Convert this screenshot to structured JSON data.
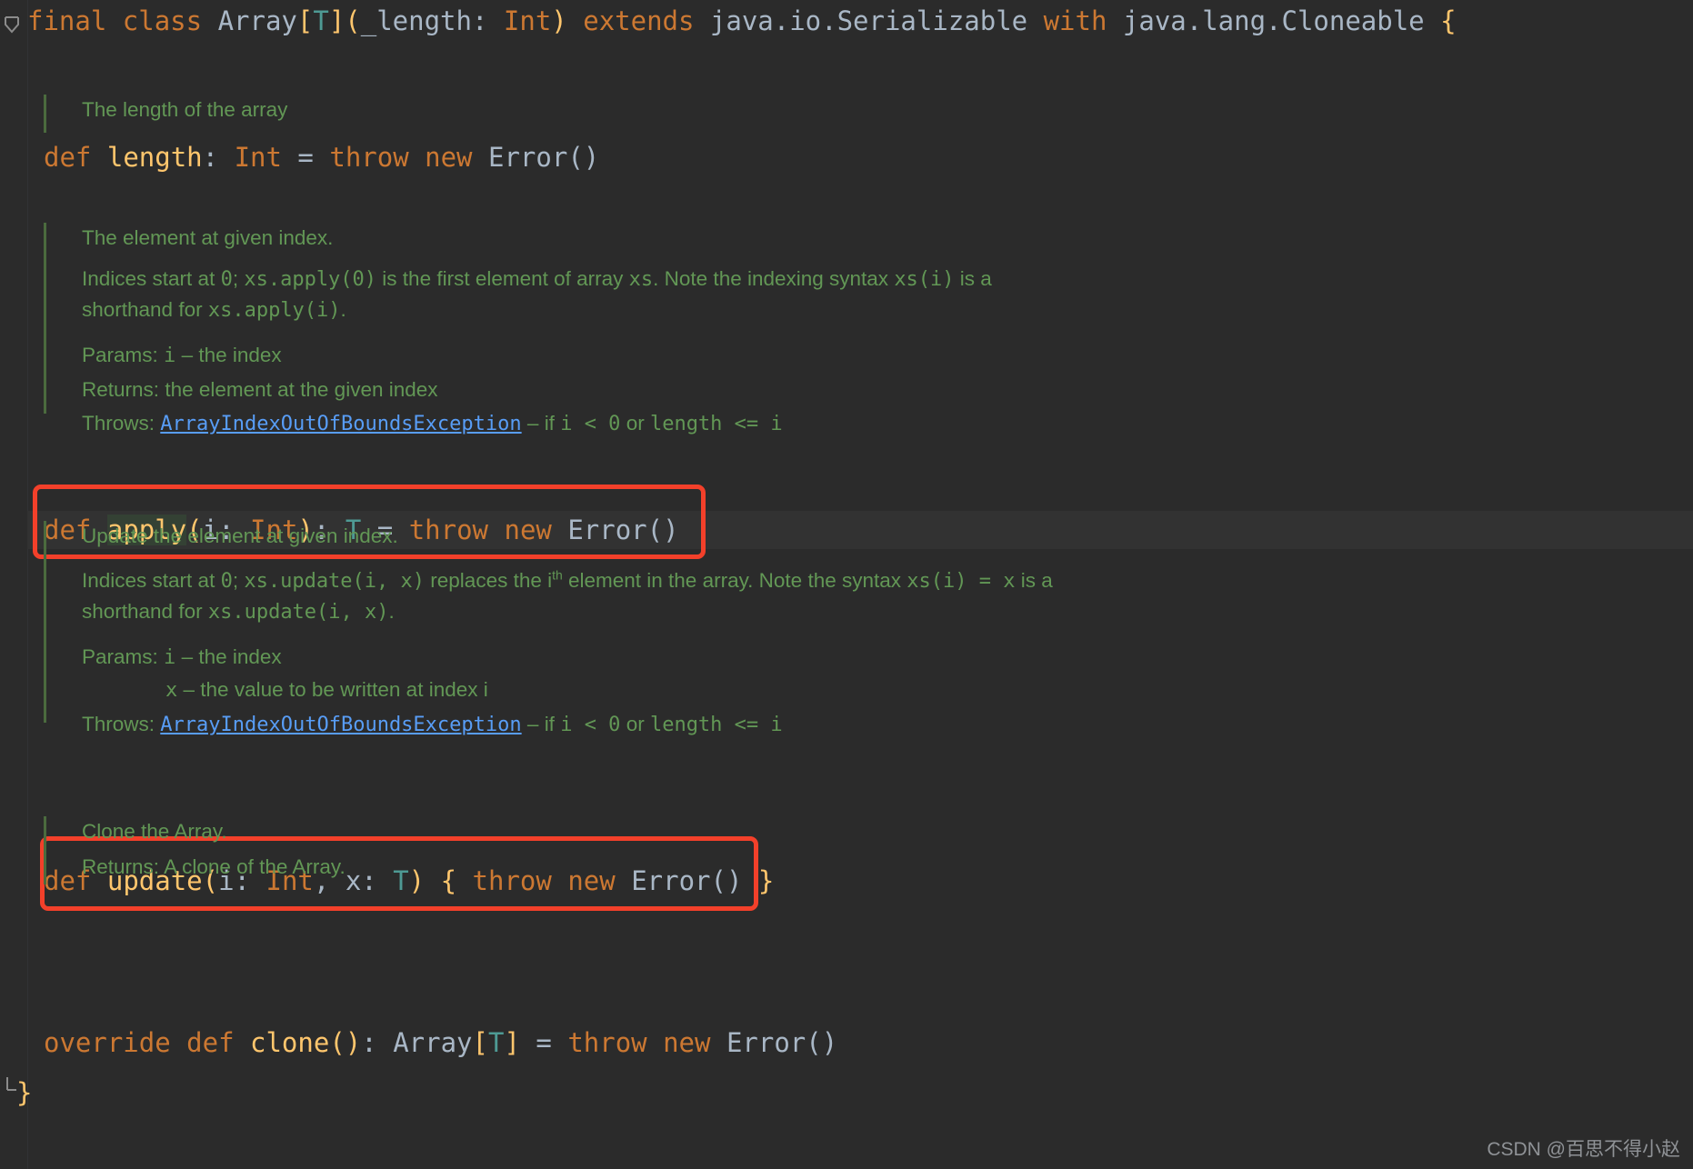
{
  "editor": {
    "language": "Scala",
    "theme": "darcula",
    "background": "#2b2b2b",
    "gutter_icon": "code-fold-collapse-arrow"
  },
  "colors": {
    "keyword": "#cc7832",
    "method_name": "#ffc66d",
    "identifier": "#a9b7c6",
    "type_param": "#4e9a94",
    "doc_comment": "#629755",
    "doc_link": "#589df6",
    "annotation_box": "#f3402a",
    "current_line": "#323232",
    "identifier_highlight": "#344134",
    "doc_bar": "#4b6b3e"
  },
  "code": {
    "class_decl": {
      "kw_final": "final",
      "kw_class": "class",
      "name": "Array",
      "bracket_open": "[",
      "type_param": "T",
      "bracket_close": "]",
      "paren_open": "(",
      "ctor_param": "_length:",
      "ctor_type": "Int",
      "paren_close": ")",
      "kw_extends": "extends",
      "super_type": "java.io.Serializable",
      "kw_with": "with",
      "mixin_type": "java.lang.Cloneable",
      "brace_open": "{"
    },
    "length_def": {
      "kw_def": "def",
      "name": "length",
      "colon": ":",
      "ret_type": "Int",
      "eq": "=",
      "kw_throw": "throw",
      "kw_new": "new",
      "error": "Error",
      "parens": "()"
    },
    "apply_def": {
      "kw_def": "def",
      "name": "apply",
      "paren_open": "(",
      "param": "i:",
      "param_type": "Int",
      "paren_close": ")",
      "colon": ":",
      "ret_type": "T",
      "eq": "=",
      "kw_throw": "throw",
      "kw_new": "new",
      "error": "Error",
      "parens": "()"
    },
    "update_def": {
      "kw_def": "def",
      "name": "update",
      "paren_open": "(",
      "param1": "i:",
      "param1_type": "Int",
      "comma": ",",
      "param2": "x:",
      "param2_type": "T",
      "paren_close": ")",
      "brace_open": "{",
      "kw_throw": "throw",
      "kw_new": "new",
      "error": "Error",
      "parens": "()",
      "brace_close": "}"
    },
    "clone_def": {
      "kw_override": "override",
      "kw_def": "def",
      "name": "clone",
      "parens": "()",
      "colon": ":",
      "ret_type": "Array",
      "bracket_open": "[",
      "type_param": "T",
      "bracket_close": "]",
      "eq": "=",
      "kw_throw": "throw",
      "kw_new": "new",
      "error": "Error",
      "err_parens": "()"
    },
    "class_close": "}"
  },
  "docs": {
    "length": {
      "summary": "The length of the array"
    },
    "apply": {
      "summary": "The element at given index.",
      "detail_1": "Indices start at ",
      "detail_code_0": "0",
      "detail_2": "; ",
      "detail_code_apply0": "xs.apply(0)",
      "detail_3": " is the first element of array ",
      "detail_code_xs": "xs",
      "detail_4": ". Note the indexing syntax ",
      "detail_code_xsi": "xs(i)",
      "detail_5": " is a shorthand for ",
      "detail_code_applyi": "xs.apply(i)",
      "detail_6": ".",
      "params_label": "Params:",
      "params_name": "i",
      "params_dash": "–",
      "params_desc": "the index",
      "returns_label": "Returns:",
      "returns_desc": "the element at the given index",
      "throws_label": "Throws:",
      "throws_link": "ArrayIndexOutOfBoundsException",
      "throws_dash": "–",
      "throws_desc_1": "if ",
      "throws_code_1": "i < 0",
      "throws_desc_2": " or ",
      "throws_code_2": "length <= i"
    },
    "update": {
      "summary": "Update the element at given index.",
      "detail_1": "Indices start at ",
      "detail_code_0": "0",
      "detail_2": "; ",
      "detail_code_update": "xs.update(i, x)",
      "detail_3": " replaces the i",
      "detail_sup": "th",
      "detail_4": " element in the array. Note the syntax ",
      "detail_code_xsi": "xs(i)",
      "detail_5": " = x",
      "detail_6": " is a shorthand for ",
      "detail_code_updatei": "xs.update(i, x)",
      "detail_7": ".",
      "params_label": "Params:",
      "params_name_1": "i",
      "params_dash_1": "–",
      "params_desc_1": "the index",
      "params_name_2": "x",
      "params_dash_2": "–",
      "params_desc_2": "the value to be written at index i",
      "throws_label": "Throws:",
      "throws_link": "ArrayIndexOutOfBoundsException",
      "throws_dash": "–",
      "throws_desc_1": "if ",
      "throws_code_1": "i < 0",
      "throws_desc_2": " or ",
      "throws_code_2": "length <= i"
    },
    "clone": {
      "summary": "Clone the Array.",
      "returns_label": "Returns:",
      "returns_desc": "A clone of the Array."
    }
  },
  "annotations": {
    "box_apply_label": "highlight-apply-method",
    "box_update_label": "highlight-update-method"
  },
  "watermark": {
    "text": "CSDN @百思不得小赵"
  }
}
